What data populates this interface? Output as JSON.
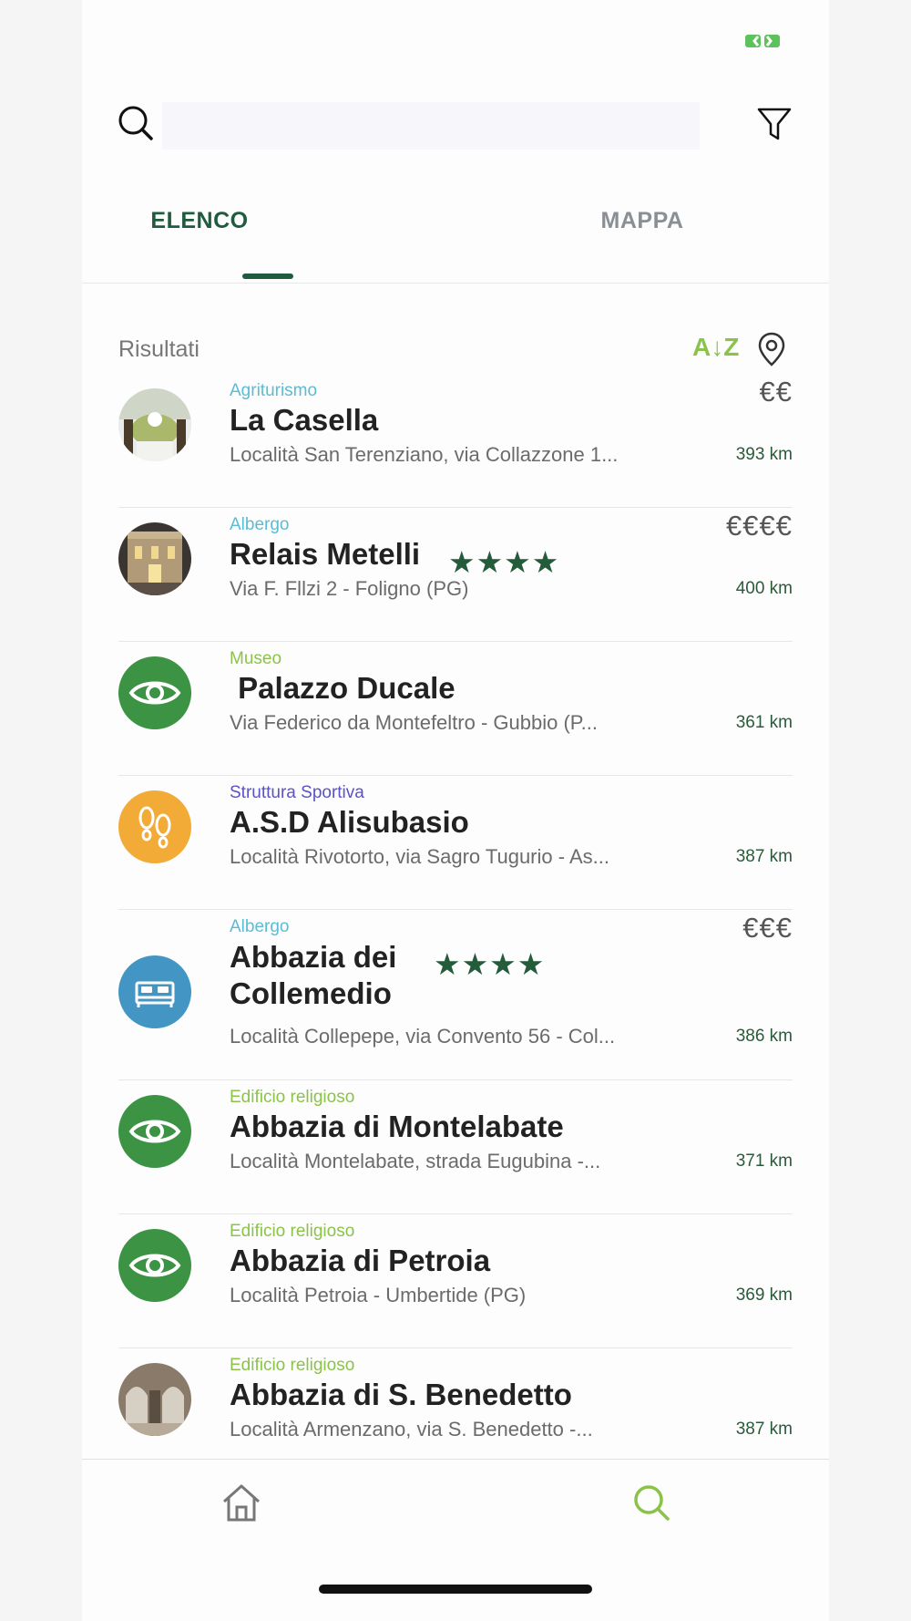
{
  "search": {
    "value": "",
    "placeholder": ""
  },
  "tabs": [
    {
      "label": "ELENCO",
      "active": true
    },
    {
      "label": "MAPPA",
      "active": false
    }
  ],
  "results": {
    "label": "Risultati",
    "sort_label": "A↓Z"
  },
  "items": [
    {
      "category": "Agriturismo",
      "category_color": "#5bbcd4",
      "name": "La Casella",
      "address": "Località San Terenziano, via Collazzone 1...",
      "distance": "393 km",
      "price": "€€",
      "stars": "",
      "avatar": "photo-casella"
    },
    {
      "category": "Albergo",
      "category_color": "#5bbcd4",
      "name": "Relais Metelli",
      "address": "Via F. Fllzi 2 - Foligno (PG)",
      "distance": "400 km",
      "price": "€€€€",
      "stars": "★★★★",
      "avatar": "photo-metelli"
    },
    {
      "category": "Museo",
      "category_color": "#8bc34a",
      "name": " Palazzo Ducale",
      "address": "Via Federico da Montefeltro - Gubbio (P...",
      "distance": "361 km",
      "price": "",
      "stars": "",
      "avatar": "eye-icon"
    },
    {
      "category": "Struttura Sportiva",
      "category_color": "#5b52c8",
      "name": "A.S.D Alisubasio",
      "address": "Località Rivotorto, via Sagro Tugurio - As...",
      "distance": "387 km",
      "price": "",
      "stars": "",
      "avatar": "footprints-icon"
    },
    {
      "category": "Albergo",
      "category_color": "#5bbcd4",
      "name": "Abbazia dei Collemedio",
      "address": "Località Collepepe, via Convento 56 - Col...",
      "distance": "386 km",
      "price": "€€€",
      "stars": "★★★★",
      "avatar": "bed-icon"
    },
    {
      "category": "Edificio religioso",
      "category_color": "#8bc34a",
      "name": "Abbazia di Montelabate",
      "address": "Località Montelabate, strada Eugubina -...",
      "distance": "371 km",
      "price": "",
      "stars": "",
      "avatar": "eye-icon"
    },
    {
      "category": "Edificio religioso",
      "category_color": "#8bc34a",
      "name": "Abbazia di Petroia",
      "address": "Località Petroia - Umbertide (PG)",
      "distance": "369 km",
      "price": "",
      "stars": "",
      "avatar": "eye-icon"
    },
    {
      "category": "Edificio religioso",
      "category_color": "#8bc34a",
      "name": "Abbazia di S. Benedetto",
      "address": "Località Armenzano, via S. Benedetto -...",
      "distance": "387 km",
      "price": "",
      "stars": "",
      "avatar": "photo-benedetto"
    }
  ],
  "nav": [
    {
      "icon": "home-icon",
      "active": false
    },
    {
      "icon": "search-icon",
      "active": true
    }
  ],
  "colors": {
    "primary": "#1f5b3e",
    "accent": "#8bc34a",
    "muted": "#8a8f96"
  }
}
